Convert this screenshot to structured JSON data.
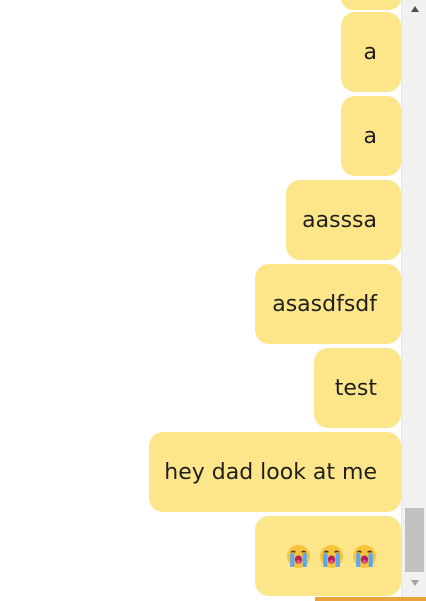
{
  "theme": {
    "bubble_color": "#fde68a",
    "accent_color": "#e8a33c",
    "scrollbar_track": "#f1f1f1",
    "scrollbar_thumb": "#c1c1c1"
  },
  "messages": [
    {
      "text": "a"
    },
    {
      "text": "a"
    },
    {
      "text": "aasssa"
    },
    {
      "text": "asasdfsdf"
    },
    {
      "text": "test"
    },
    {
      "text": "hey dad look at me"
    },
    {
      "emoji": [
        "loudly-crying-face",
        "loudly-crying-face",
        "loudly-crying-face"
      ]
    }
  ],
  "icons": {
    "scroll_up": "triangle-up-icon",
    "scroll_down": "triangle-down-icon"
  }
}
